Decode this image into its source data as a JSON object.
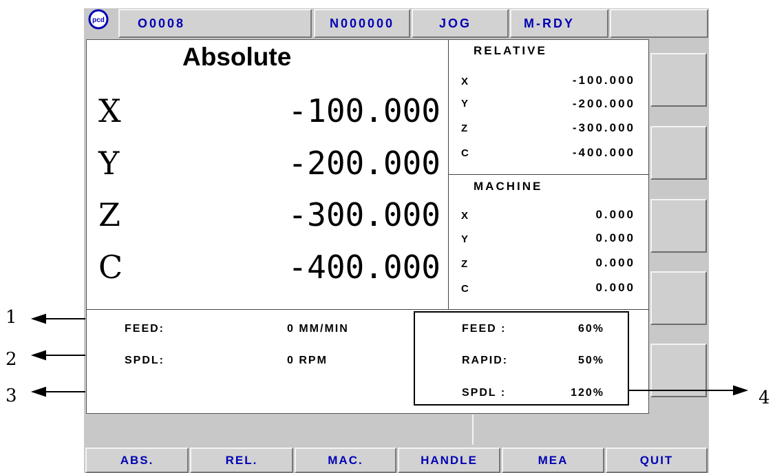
{
  "status_bar": {
    "program": "O0008",
    "sequence": "N000000",
    "mode": "JOG",
    "state": "M-RDY"
  },
  "absolute": {
    "title": "Absolute",
    "axes": [
      {
        "axis": "X",
        "value": "-100.000"
      },
      {
        "axis": "Y",
        "value": "-200.000"
      },
      {
        "axis": "Z",
        "value": "-300.000"
      },
      {
        "axis": "C",
        "value": "-400.000"
      }
    ]
  },
  "relative": {
    "title": "RELATIVE",
    "axes": [
      {
        "axis": "X",
        "value": "-100.000"
      },
      {
        "axis": "Y",
        "value": "-200.000"
      },
      {
        "axis": "Z",
        "value": "-300.000"
      },
      {
        "axis": "C",
        "value": "-400.000"
      }
    ]
  },
  "machine": {
    "title": "MACHINE",
    "axes": [
      {
        "axis": "X",
        "value": "0.000"
      },
      {
        "axis": "Y",
        "value": "0.000"
      },
      {
        "axis": "Z",
        "value": "0.000"
      },
      {
        "axis": "C",
        "value": "0.000"
      }
    ]
  },
  "info": {
    "feed_label": "FEED:",
    "feed_value": "0 MM/MIN",
    "spdl_label": "SPDL:",
    "spdl_value": "0 RPM"
  },
  "override": {
    "feed_label": "FEED :",
    "feed_value": "60%",
    "rapid_label": "RAPID:",
    "rapid_value": "50%",
    "spdl_label": "SPDL :",
    "spdl_value": "120%"
  },
  "softkeys": [
    "ABS.",
    "REL.",
    "MAC.",
    "HANDLE",
    "MEA",
    "QUIT"
  ],
  "callouts": [
    "1",
    "2",
    "3",
    "4"
  ],
  "colors": {
    "panel_bg": "#c8c8c8",
    "label_blue": "#0000b4",
    "screen_bg": "#ffffff"
  },
  "icons": {
    "logo": "pcd-logo"
  }
}
